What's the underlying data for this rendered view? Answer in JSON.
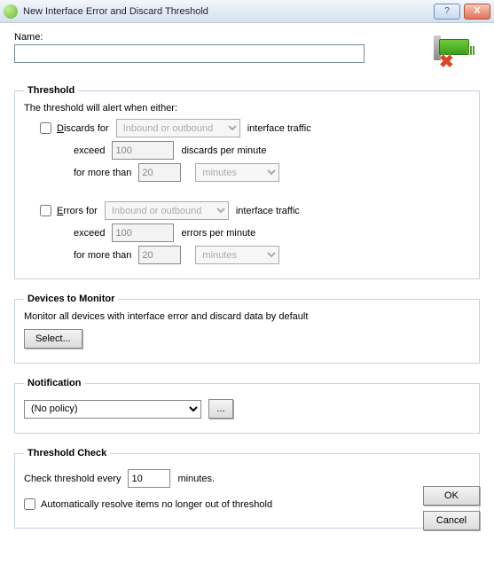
{
  "window": {
    "title": "New Interface Error and Discard Threshold",
    "help": "?",
    "close": "X"
  },
  "name": {
    "label": "Name:",
    "value": ""
  },
  "threshold": {
    "legend": "Threshold",
    "intro": "The threshold will alert when either:",
    "discards": {
      "checked": false,
      "prefix_u": "D",
      "prefix_rest": "iscards for",
      "direction": "Inbound or outbound",
      "suffix1": "interface traffic",
      "exceed_label": "exceed",
      "exceed_value": "100",
      "exceed_unit": "discards per minute",
      "for_label": "for more than",
      "for_value": "20",
      "for_unit": "minutes"
    },
    "errors": {
      "checked": false,
      "prefix_u": "E",
      "prefix_rest": "rrors for",
      "direction": "Inbound or outbound",
      "suffix1": "interface traffic",
      "exceed_label": "exceed",
      "exceed_value": "100",
      "exceed_unit": "errors per minute",
      "for_label": "for more than",
      "for_value": "20",
      "for_unit": "minutes"
    }
  },
  "devices": {
    "legend": "Devices to Monitor",
    "desc": "Monitor all devices with interface error and discard data by default",
    "select_btn": "Select..."
  },
  "notification": {
    "legend": "Notification",
    "policy": "(No policy)",
    "edit": "..."
  },
  "check": {
    "legend": "Threshold Check",
    "prefix": "Check threshold every",
    "value": "10",
    "suffix": "minutes.",
    "auto_resolve_checked": false,
    "auto_resolve": "Automatically resolve items no longer out of threshold"
  },
  "buttons": {
    "ok": "OK",
    "cancel": "Cancel"
  }
}
